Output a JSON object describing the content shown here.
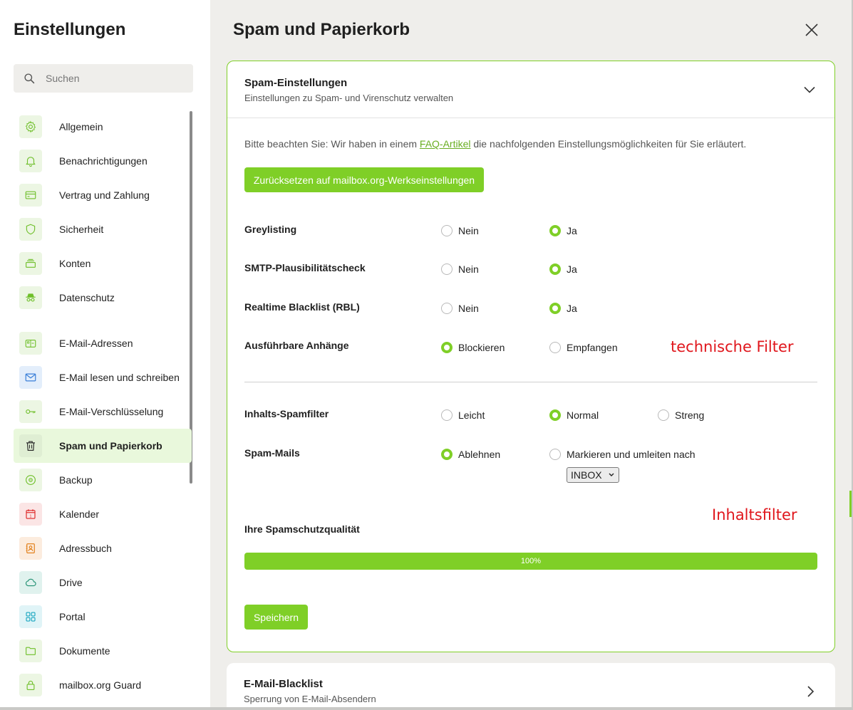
{
  "sidebar": {
    "title": "Einstellungen",
    "search_placeholder": "Suchen",
    "items": [
      {
        "label": "Allgemein",
        "icon": "gear-icon"
      },
      {
        "label": "Benachrichtigungen",
        "icon": "bell-icon"
      },
      {
        "label": "Vertrag und Zahlung",
        "icon": "credit-card-icon"
      },
      {
        "label": "Sicherheit",
        "icon": "shield-icon"
      },
      {
        "label": "Konten",
        "icon": "stack-icon"
      },
      {
        "label": "Datenschutz",
        "icon": "incognito-icon"
      },
      {
        "label": "E-Mail-Adressen",
        "icon": "address-card-icon"
      },
      {
        "label": "E-Mail lesen und schreiben",
        "icon": "envelope-icon"
      },
      {
        "label": "E-Mail-Verschlüsselung",
        "icon": "key-icon"
      },
      {
        "label": "Spam und Papierkorb",
        "icon": "trash-icon",
        "active": true
      },
      {
        "label": "Backup",
        "icon": "backup-icon"
      },
      {
        "label": "Kalender",
        "icon": "calendar-icon",
        "icon_text": "1"
      },
      {
        "label": "Adressbuch",
        "icon": "contact-book-icon"
      },
      {
        "label": "Drive",
        "icon": "cloud-icon"
      },
      {
        "label": "Portal",
        "icon": "grid-icon"
      },
      {
        "label": "Dokumente",
        "icon": "folder-icon"
      },
      {
        "label": "mailbox.org Guard",
        "icon": "lock-icon"
      }
    ]
  },
  "main": {
    "title": "Spam und Papierkorb",
    "spam_card": {
      "title": "Spam-Einstellungen",
      "subtitle": "Einstellungen zu Spam- und Virenschutz verwalten",
      "note_before": "Bitte beachten Sie: Wir haben in einem ",
      "note_link": "FAQ-Artikel",
      "note_after": " die nachfolgenden Einstellungsmöglichkeiten für Sie erläutert.",
      "reset_button": "Zurücksetzen auf mailbox.org-Werkseinstellungen",
      "rows": [
        {
          "label": "Greylisting",
          "options": [
            "Nein",
            "Ja"
          ],
          "selected": "Ja"
        },
        {
          "label": "SMTP-Plausibilitätscheck",
          "options": [
            "Nein",
            "Ja"
          ],
          "selected": "Ja"
        },
        {
          "label": "Realtime Blacklist (RBL)",
          "options": [
            "Nein",
            "Ja"
          ],
          "selected": "Ja"
        },
        {
          "label": "Ausführbare Anhänge",
          "options": [
            "Blockieren",
            "Empfangen"
          ],
          "selected": "Blockieren"
        },
        {
          "label": "Inhalts-Spamfilter",
          "options": [
            "Leicht",
            "Normal",
            "Streng"
          ],
          "selected": "Normal"
        },
        {
          "label": "Spam-Mails",
          "options": [
            "Ablehnen",
            "Markieren und umleiten nach"
          ],
          "selected": "Ablehnen"
        }
      ],
      "folder_select": "INBOX",
      "quality_label": "Ihre Spamschutzqualität",
      "quality_percent": 100,
      "quality_text": "100%",
      "save_button": "Speichern"
    },
    "annotations": {
      "technical": "technische Filter",
      "content": "Inhaltsfilter"
    },
    "blacklist_card": {
      "title": "E-Mail-Blacklist",
      "subtitle": "Sperrung von E-Mail-Absendern"
    }
  },
  "colors": {
    "accent": "#7fcf27",
    "annotation": "#e0161c",
    "active_nav": "#e9f8dc"
  }
}
